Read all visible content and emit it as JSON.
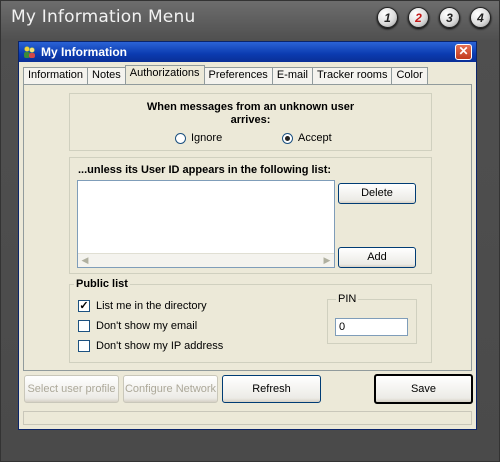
{
  "app": {
    "title": "My Information Menu",
    "steps": [
      "1",
      "2",
      "3",
      "4"
    ],
    "active_step": "2"
  },
  "window": {
    "title": "My Information",
    "close_label": "✕",
    "tabs": [
      "Information",
      "Notes",
      "Authorizations",
      "Preferences",
      "E-mail",
      "Tracker rooms",
      "Color"
    ],
    "active_tab": "Authorizations"
  },
  "messages": {
    "title": "When messages from an unknown user arrives:",
    "options": [
      {
        "label": "Ignore",
        "selected": false
      },
      {
        "label": "Accept",
        "selected": true
      }
    ]
  },
  "exceptions": {
    "label": "...unless its User ID appears in the following list:",
    "delete_label": "Delete",
    "add_label": "Add",
    "items": []
  },
  "public_list": {
    "legend": "Public list",
    "options": [
      {
        "label": "List me in the directory",
        "checked": true
      },
      {
        "label": "Don't show my email",
        "checked": false
      },
      {
        "label": "Don't show my IP address",
        "checked": false
      }
    ],
    "pin_label": "PIN",
    "pin_value": "0"
  },
  "actions": {
    "select_profile": "Select user profile",
    "configure_network": "Configure Network",
    "refresh": "Refresh",
    "save": "Save"
  },
  "colors": {
    "titlebar": "#0b3bb0",
    "active_step": "#c41818",
    "dialog_bg": "#ece9d8"
  }
}
